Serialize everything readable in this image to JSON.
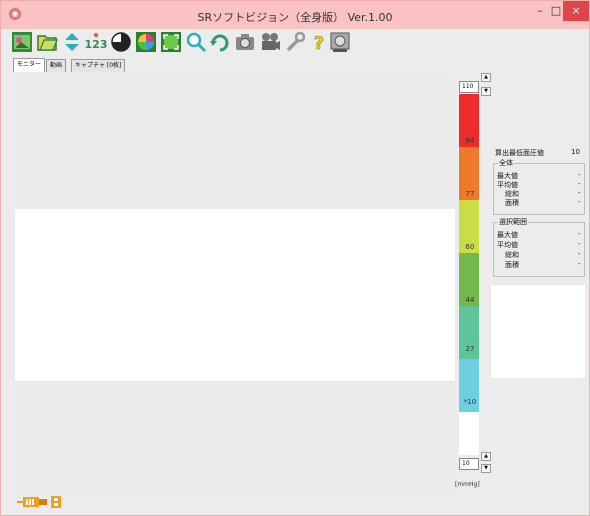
{
  "window": {
    "title": "SRソフトビジョン（全身版） Ver.1.00",
    "minimize_glyph": "–",
    "maximize_glyph": "□",
    "close_glyph": "×"
  },
  "toolbar": {
    "icons": [
      "open-image-icon",
      "folder-icon",
      "up-down-arrows-icon",
      "number-123-icon",
      "contrast-circle-icon",
      "color-wheel-icon",
      "frame-select-icon",
      "magnify-icon",
      "rotate-icon",
      "camera-icon",
      "film-camera-icon",
      "wrench-icon",
      "help-question-icon",
      "sensor-icon"
    ],
    "number_label": "123"
  },
  "tabs": [
    {
      "label": "モニター",
      "active": true
    },
    {
      "label": "動画",
      "active": false
    },
    {
      "label": "キャプチャ [0枚]",
      "active": false
    }
  ],
  "scale": {
    "max_value": "110",
    "min_value": "10",
    "unit": "[mmHg]",
    "labels": [
      "94",
      "77",
      "60",
      "44",
      "27",
      "*10"
    ],
    "colors": [
      "#ee2a2a",
      "#f07a2c",
      "#c9dd45",
      "#72b84a",
      "#5ec59a",
      "#6ecfe1",
      "#ffffff"
    ]
  },
  "panel": {
    "min_pressure_label": "算出最低面圧値",
    "min_pressure_value": "10",
    "overall": {
      "title": "全体",
      "max_label": "最大値",
      "max_value": "-",
      "avg_label": "平均値",
      "avg_value": "-",
      "sum_label": "総和",
      "sum_value": "-",
      "area_label": "面積",
      "area_value": "-"
    },
    "selection": {
      "title": "選択範囲",
      "max_label": "最大値",
      "max_value": "-",
      "avg_label": "平均値",
      "avg_value": "-",
      "sum_label": "総和",
      "sum_value": "-",
      "area_label": "面積",
      "area_value": "-"
    }
  }
}
